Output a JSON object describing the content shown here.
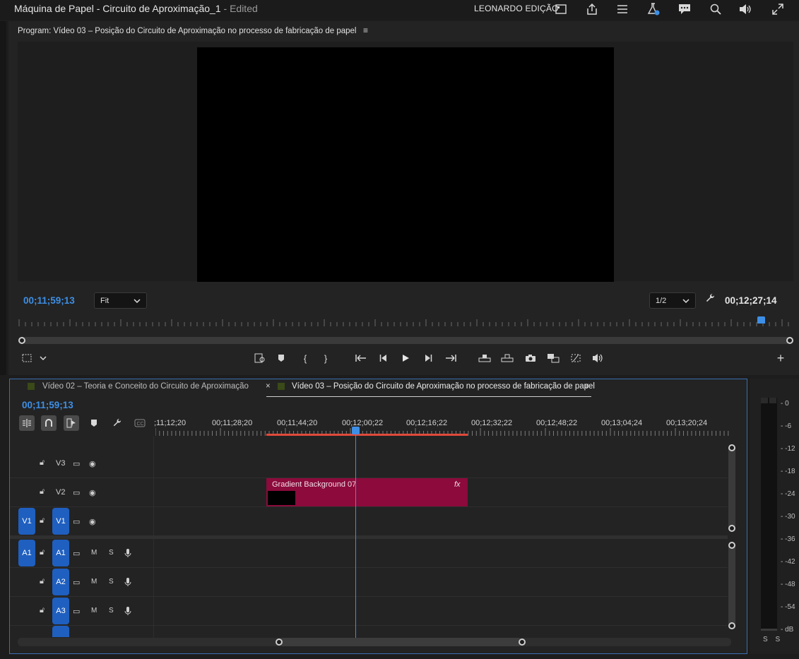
{
  "app": {
    "title": "Máquina de Papel - Circuito de Aproximação_1",
    "edited": "- Edited",
    "workspace": "LEONARDO EDIÇÃO"
  },
  "titlebar_icons": [
    "panel-icon",
    "share-icon",
    "menu-list-icon",
    "beta-flask-icon",
    "comments-icon",
    "search-zoom-icon",
    "volume-icon",
    "fullscreen-icon"
  ],
  "program": {
    "tab_label": "Program: Vídeo 03 – Posição do Circuito de Aproximação no processo de fabricação de papel",
    "menu_glyph": "≡",
    "timecode": "00;11;59;13",
    "duration": "00;12;27;14",
    "zoom_select": "Fit",
    "resolution_select": "1/2",
    "playhead_fraction": 0.958
  },
  "transport_icons": [
    "insert-marker-list-icon",
    "add-marker-icon",
    "mark-in-icon",
    "mark-out-icon",
    "go-to-in-icon",
    "step-back-icon",
    "play-icon",
    "step-forward-icon",
    "go-to-out-icon",
    "lift-icon",
    "extract-icon",
    "export-frame-icon",
    "compare-icon",
    "trim-icon",
    "audio-icon"
  ],
  "timeline": {
    "tabs": [
      {
        "label": "Vídeo 02 – Teoria e Conceito do Circuito de Aproximação",
        "close": ""
      },
      {
        "label": "Vídeo 03 – Posição do Circuito de Aproximação no processo de fabricação de papel",
        "close": "×",
        "menu": "≡"
      }
    ],
    "timecode": "00;11;59;13",
    "ruler_labels": [
      ";11;12;20",
      "00;11;28;20",
      "00;11;44;20",
      "00;12;00;22",
      "00;12;16;22",
      "00;12;32;22",
      "00;12;48;22",
      "00;13;04;24",
      "00;13;20;24"
    ],
    "tools": [
      "nest-icon",
      "snap-icon",
      "linked-selection-icon",
      "add-marker-icon",
      "wrench-icon",
      "captions-icon"
    ],
    "video_tracks": [
      {
        "name": "V3",
        "source": "",
        "target": ""
      },
      {
        "name": "V2",
        "source": "",
        "target": ""
      },
      {
        "name": "V1",
        "source": "V1",
        "target": "V1"
      }
    ],
    "audio_tracks": [
      {
        "name": "A1",
        "source": "A1",
        "target": "A1",
        "m": "M",
        "s": "S"
      },
      {
        "name": "A2",
        "source": "",
        "target": "A2",
        "m": "M",
        "s": "S"
      },
      {
        "name": "A3",
        "source": "",
        "target": "A3",
        "m": "M",
        "s": "S"
      }
    ],
    "clip": {
      "label": "Gradient Background 07",
      "fx": "fx",
      "color": "#8c0a3c"
    }
  },
  "meter": {
    "labels": [
      "0",
      "-6",
      "-12",
      "-18",
      "-24",
      "-30",
      "-36",
      "-42",
      "-48",
      "-54",
      "dB"
    ],
    "solo": "S S"
  },
  "colors": {
    "accent": "#3d8fe6",
    "clip": "#8c0a3c",
    "workarea": "#e04a3a"
  }
}
